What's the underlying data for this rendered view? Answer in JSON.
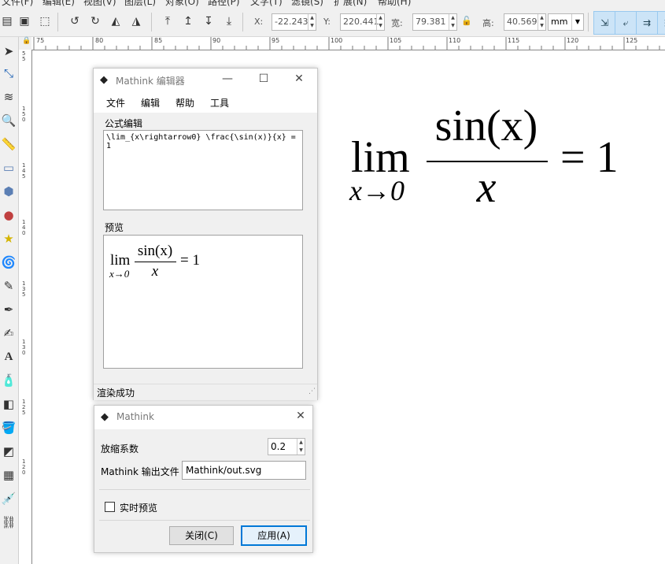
{
  "menubar": [
    "文件(F)",
    "编辑(E)",
    "视图(V)",
    "图层(L)",
    "对象(O)",
    "路径(P)",
    "文字(T)",
    "滤镜(S)",
    "扩展(N)",
    "帮助(H)"
  ],
  "toolbar": {
    "x_label": "X:",
    "x_value": "-22.243",
    "y_label": "Y:",
    "y_value": "220.441",
    "w_label": "宽:",
    "w_value": "79.381",
    "h_label": "高:",
    "h_value": "40.569",
    "unit": "mm"
  },
  "ruler": {
    "h_ticks": [
      "75",
      "80",
      "85",
      "90",
      "95",
      "100",
      "105",
      "110",
      "115",
      "120",
      "125"
    ],
    "v_ticks": [
      "55",
      "150",
      "145",
      "140",
      "135",
      "130",
      "125",
      "120"
    ]
  },
  "editor": {
    "title": "Mathink 编辑器",
    "menu": [
      "文件",
      "编辑",
      "帮助",
      "工具"
    ],
    "formula_label": "公式编辑",
    "latex": "\\lim_{x\\rightarrow0} \\frac{\\sin(x)}{x} = 1",
    "preview_label": "预览",
    "status": "渲染成功"
  },
  "settings": {
    "title": "Mathink",
    "scale_label": "放缩系数",
    "scale_value": "0.2",
    "output_label": "Mathink 输出文件",
    "output_value": "Mathink/out.svg",
    "realtime_label": "实时预览",
    "realtime_checked": false,
    "close_label": "关闭(C)",
    "apply_label": "应用(A)"
  },
  "formula": {
    "lim": "lim",
    "sub": "x→0",
    "numerator": "sin(x)",
    "denominator": "x",
    "rhs": "= 1"
  }
}
